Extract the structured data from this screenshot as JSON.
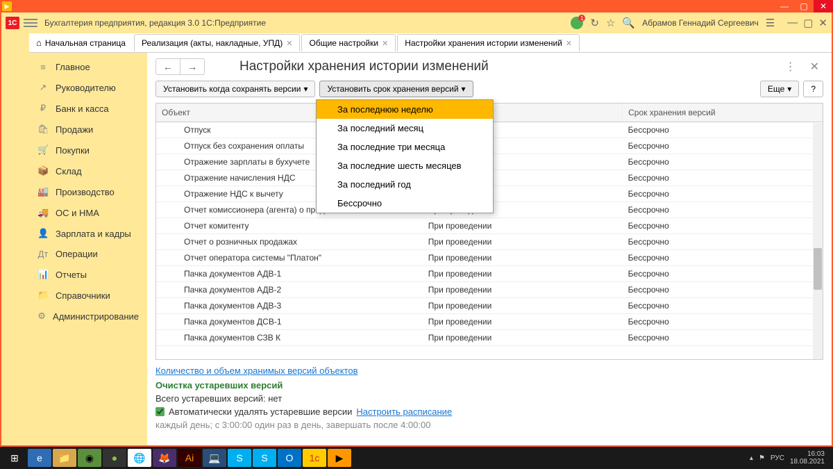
{
  "app": {
    "title": "Бухгалтерия предприятия, редакция 3.0 1С:Предприятие",
    "user": "Абрамов Геннадий Сергеевич"
  },
  "tabs": {
    "home": "Начальная страница",
    "items": [
      {
        "label": "Реализация (акты, накладные, УПД)"
      },
      {
        "label": "Общие настройки"
      },
      {
        "label": "Настройки хранения истории изменений"
      }
    ]
  },
  "sidebar": {
    "items": [
      {
        "icon": "≡",
        "label": "Главное"
      },
      {
        "icon": "↗",
        "label": "Руководителю"
      },
      {
        "icon": "₽",
        "label": "Банк и касса"
      },
      {
        "icon": "🛍",
        "label": "Продажи"
      },
      {
        "icon": "🛒",
        "label": "Покупки"
      },
      {
        "icon": "📦",
        "label": "Склад"
      },
      {
        "icon": "🏭",
        "label": "Производство"
      },
      {
        "icon": "🚚",
        "label": "ОС и НМА"
      },
      {
        "icon": "👤",
        "label": "Зарплата и кадры"
      },
      {
        "icon": "Дт",
        "label": "Операции"
      },
      {
        "icon": "📊",
        "label": "Отчеты"
      },
      {
        "icon": "📁",
        "label": "Справочники"
      },
      {
        "icon": "⚙",
        "label": "Администрирование"
      }
    ]
  },
  "page": {
    "title": "Настройки хранения истории изменений",
    "btn_when": "Установить когда сохранять версии",
    "btn_term": "Установить срок хранения версий",
    "btn_more": "Еще",
    "btn_help": "?"
  },
  "dropdown": {
    "items": [
      "За последнюю неделю",
      "За последний месяц",
      "За последние три месяца",
      "За последние шесть месяцев",
      "За последний год",
      "Бессрочно"
    ]
  },
  "table": {
    "cols": [
      "Объект",
      "",
      "Срок хранения версий"
    ],
    "rows": [
      {
        "c1": "Отпуск",
        "c2": "",
        "c3": "Бессрочно"
      },
      {
        "c1": "Отпуск без сохранения оплаты",
        "c2": "",
        "c3": "Бессрочно"
      },
      {
        "c1": "Отражение зарплаты в бухучете",
        "c2": "",
        "c3": "Бессрочно"
      },
      {
        "c1": "Отражение начисления НДС",
        "c2": "",
        "c3": "Бессрочно"
      },
      {
        "c1": "Отражение НДС к вычету",
        "c2": "",
        "c3": "Бессрочно"
      },
      {
        "c1": "Отчет комиссионера (агента) о продажах",
        "c2": "При проведении",
        "c3": "Бессрочно"
      },
      {
        "c1": "Отчет комитенту",
        "c2": "При проведении",
        "c3": "Бессрочно"
      },
      {
        "c1": "Отчет о розничных продажах",
        "c2": "При проведении",
        "c3": "Бессрочно"
      },
      {
        "c1": "Отчет оператора системы \"Платон\"",
        "c2": "При проведении",
        "c3": "Бессрочно"
      },
      {
        "c1": "Пачка документов АДВ-1",
        "c2": "При проведении",
        "c3": "Бессрочно"
      },
      {
        "c1": "Пачка документов АДВ-2",
        "c2": "При проведении",
        "c3": "Бессрочно"
      },
      {
        "c1": "Пачка документов АДВ-3",
        "c2": "При проведении",
        "c3": "Бессрочно"
      },
      {
        "c1": "Пачка документов ДСВ-1",
        "c2": "При проведении",
        "c3": "Бессрочно"
      },
      {
        "c1": "Пачка документов СЗВ К",
        "c2": "При проведении",
        "c3": "Бессрочно"
      }
    ]
  },
  "footer": {
    "link": "Количество и объем хранимых версий объектов",
    "green": "Очистка устаревших версий",
    "total": "Всего устаревших версий: нет",
    "auto": "Автоматически удалять устаревшие версии",
    "sched": "Настроить расписание",
    "sched_text": "каждый день; с 3:00:00 один раз в день, завершать после 4:00:00"
  },
  "tray": {
    "lang": "РУС",
    "time": "16:03",
    "date": "18.08.2021"
  }
}
